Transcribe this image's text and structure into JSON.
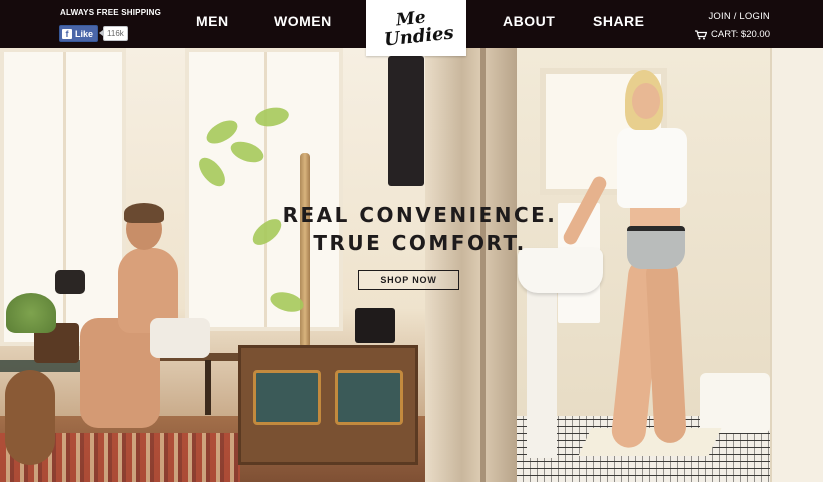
{
  "header": {
    "promo": "ALWAYS FREE SHIPPING",
    "facebook": {
      "like_label": "Like",
      "like_count": "116k",
      "icon": "facebook-icon"
    },
    "nav_left": [
      {
        "label": "MEN"
      },
      {
        "label": "WOMEN"
      }
    ],
    "logo": {
      "line1": "Me",
      "line2": "Undies"
    },
    "nav_right": [
      {
        "label": "ABOUT"
      },
      {
        "label": "SHARE"
      }
    ],
    "account": {
      "join_login": "JOIN / LOGIN"
    },
    "cart": {
      "label": "CART: $20.00",
      "icon": "cart-icon"
    }
  },
  "hero": {
    "headline_line1": "REAL CONVENIENCE.",
    "headline_line2": "TRUE COMFORT.",
    "cta": "SHOP NOW"
  },
  "colors": {
    "header_bg": "#150a0c",
    "facebook_blue": "#4a66a9",
    "text_dark": "#1e1b1c"
  }
}
